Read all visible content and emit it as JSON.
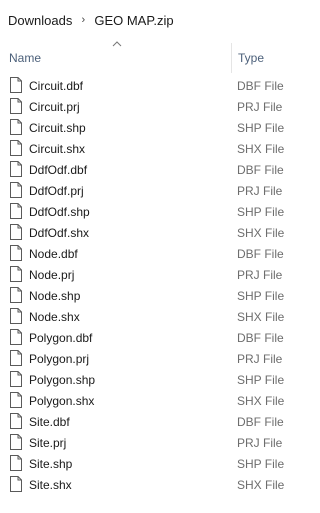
{
  "breadcrumb": {
    "items": [
      "Downloads",
      "GEO MAP.zip"
    ],
    "separator": "›"
  },
  "columns": {
    "name": "Name",
    "type": "Type"
  },
  "sort": {
    "column": "name",
    "direction": "ascending",
    "icon": "chevron-up-icon"
  },
  "files": [
    {
      "name": "Circuit.dbf",
      "type": "DBF File"
    },
    {
      "name": "Circuit.prj",
      "type": "PRJ File"
    },
    {
      "name": "Circuit.shp",
      "type": "SHP File"
    },
    {
      "name": "Circuit.shx",
      "type": "SHX File"
    },
    {
      "name": "DdfOdf.dbf",
      "type": "DBF File"
    },
    {
      "name": "DdfOdf.prj",
      "type": "PRJ File"
    },
    {
      "name": "DdfOdf.shp",
      "type": "SHP File"
    },
    {
      "name": "DdfOdf.shx",
      "type": "SHX File"
    },
    {
      "name": "Node.dbf",
      "type": "DBF File"
    },
    {
      "name": "Node.prj",
      "type": "PRJ File"
    },
    {
      "name": "Node.shp",
      "type": "SHP File"
    },
    {
      "name": "Node.shx",
      "type": "SHX File"
    },
    {
      "name": "Polygon.dbf",
      "type": "DBF File"
    },
    {
      "name": "Polygon.prj",
      "type": "PRJ File"
    },
    {
      "name": "Polygon.shp",
      "type": "SHP File"
    },
    {
      "name": "Polygon.shx",
      "type": "SHX File"
    },
    {
      "name": "Site.dbf",
      "type": "DBF File"
    },
    {
      "name": "Site.prj",
      "type": "PRJ File"
    },
    {
      "name": "Site.shp",
      "type": "SHP File"
    },
    {
      "name": "Site.shx",
      "type": "SHX File"
    }
  ],
  "colors": {
    "header_text": "#4c607a",
    "type_text": "#6d6d6d",
    "name_text": "#1a1a1a",
    "divider": "#e5e5e5"
  },
  "file_icon": "blank-file-icon"
}
